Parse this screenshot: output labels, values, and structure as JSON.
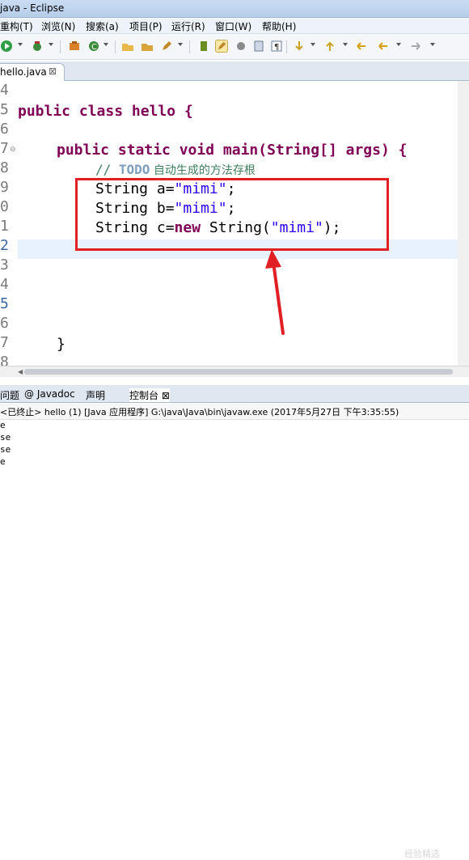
{
  "window": {
    "title": "java - Eclipse"
  },
  "menu": {
    "items": [
      "重构(T)",
      "浏览(N)",
      "搜索(a)",
      "项目(P)",
      "运行(R)",
      "窗口(W)",
      "帮助(H)"
    ]
  },
  "editor": {
    "tab_label": "hello.java",
    "close_glyph": "⊠",
    "line_numbers": [
      "4",
      "5",
      "6",
      "7",
      "8",
      "9",
      "0",
      "1",
      "2",
      "3",
      "4",
      "5",
      "6",
      "7",
      "8"
    ],
    "lines": {
      "l5": "public class hello {",
      "l7": "public static void main(String[] args) {",
      "l8_cmt": "// ",
      "l8_todo": "TODO",
      "l8_rest": " 自动生成的方法存根",
      "l9a": "String a=",
      "l9s": "\"mimi\"",
      "l9b": ";",
      "l10a": "String b=",
      "l10s": "\"mimi\"",
      "l10b": ";",
      "l11a": "String c=",
      "l11kw": "new",
      "l11b": " String(",
      "l11s": "\"mimi\"",
      "l11c": ");",
      "l17": "}"
    }
  },
  "bottom_tabs": [
    "问题",
    "@ Javadoc",
    "声明",
    "控制台 ⊠"
  ],
  "console": {
    "header": "<已终止> hello (1) [Java 应用程序] G:\\java\\Java\\bin\\javaw.exe (2017年5月27日 下午3:35:55)",
    "output": [
      "e",
      "se",
      "se",
      "e"
    ]
  },
  "colors": {
    "highlight": "#e02025",
    "keyword": "#7f0055",
    "string": "#2a00ff",
    "comment": "#3f7f5f"
  },
  "icons": [
    "run-icon",
    "debug-icon",
    "new-icon",
    "open-icon",
    "search-icon",
    "mark-icon",
    "toggle-icon",
    "nav-back-icon",
    "nav-forward-icon"
  ],
  "watermark": "经验精选"
}
